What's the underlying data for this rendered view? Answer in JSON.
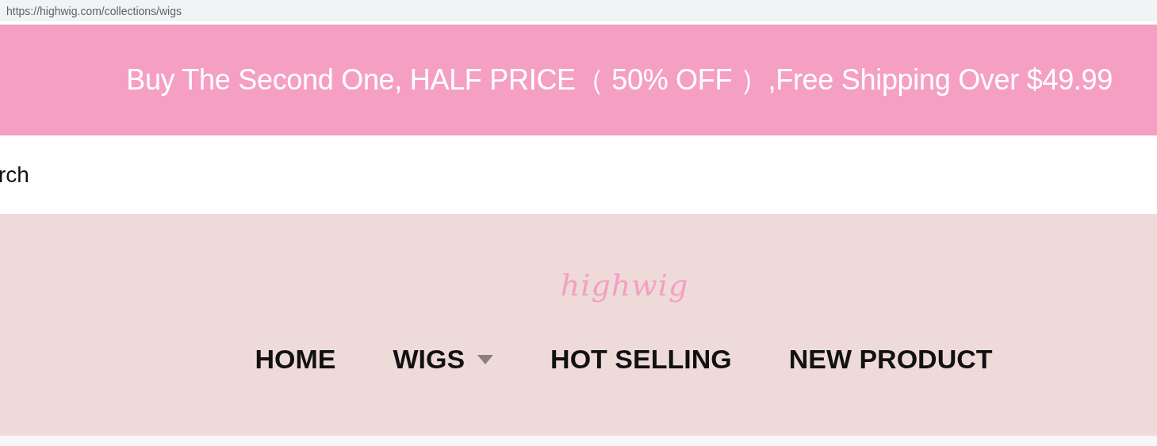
{
  "address_bar": {
    "url": "https://highwig.com/collections/wigs"
  },
  "promo_banner": {
    "text": "Buy The Second One, HALF PRICE（ 50% OFF ）,Free Shipping Over $49.99"
  },
  "search": {
    "label": "rch"
  },
  "logo": {
    "text": "highwig"
  },
  "nav": [
    {
      "label": "HOME",
      "has_dropdown": false
    },
    {
      "label": "WIGS",
      "has_dropdown": true
    },
    {
      "label": "HOT SELLING",
      "has_dropdown": false
    },
    {
      "label": "NEW PRODUCT",
      "has_dropdown": false
    }
  ]
}
